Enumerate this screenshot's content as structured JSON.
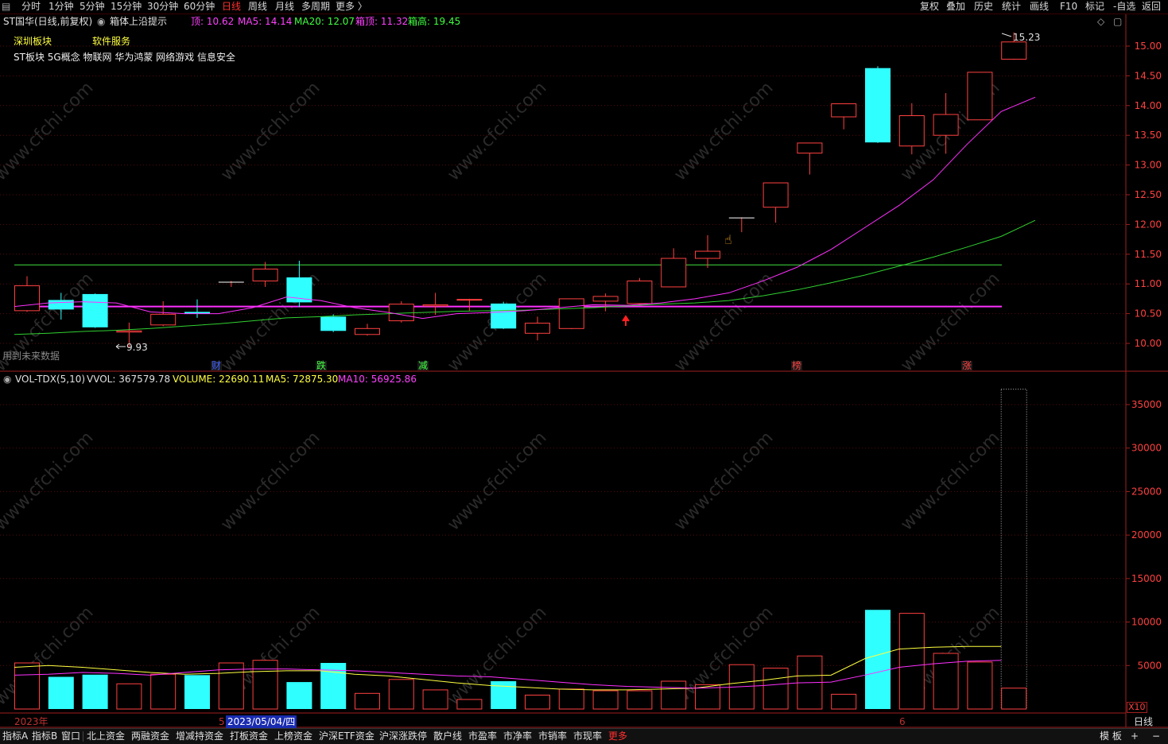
{
  "top_toolbar": {
    "periods": [
      "分时",
      "1分钟",
      "5分钟",
      "15分钟",
      "30分钟",
      "60分钟",
      "日线",
      "周线",
      "月线",
      "多周期",
      "更多 〉"
    ],
    "active_period": "日线",
    "right_tools": [
      "复权",
      "叠加",
      "历史",
      "统计",
      "画线",
      "F10",
      "标记",
      "-自选",
      "返回"
    ]
  },
  "info_bar": {
    "stock": "ST国华(日线,前复权)",
    "indicator_name": "箱体上沿提示",
    "values": [
      {
        "text": "顶: 10.62",
        "color": "#ff40ff"
      },
      {
        "text": "MA5: 14.14",
        "color": "#ff40ff"
      },
      {
        "text": "MA20: 12.07",
        "color": "#40ff40"
      },
      {
        "text": "箱顶: 11.32",
        "color": "#ff40ff"
      },
      {
        "text": "箱高: 19.45",
        "color": "#40ff40"
      }
    ]
  },
  "blocks": {
    "region": "深圳板块",
    "industry": "软件服务",
    "concepts": "ST板块 5G概念 物联网 华为鸿蒙 网络游戏 信息安全"
  },
  "price_axis": {
    "labels": [
      "15.00",
      "14.50",
      "14.00",
      "13.50",
      "13.00",
      "12.50",
      "12.00",
      "11.50",
      "11.00",
      "10.50",
      "10.00"
    ]
  },
  "annotations": {
    "high_label": "15.23",
    "low_label": "9.93",
    "future_data_note": "用到未来数据",
    "event_markers": [
      {
        "text": "财",
        "color": "#4060ff"
      },
      {
        "text": "跌",
        "color": "#40ff40"
      },
      {
        "text": "减",
        "color": "#40ff40"
      },
      {
        "text": "榜",
        "color": "#ff4040"
      },
      {
        "text": "涨",
        "color": "#ff4040"
      }
    ]
  },
  "volume_info": {
    "name": "VOL-TDX(5,10)",
    "vvol": "VVOL: 367579.78",
    "volume": "VOLUME: 22690.11",
    "ma5": "MA5: 72875.30",
    "ma10": "MA10: 56925.86"
  },
  "volume_axis": {
    "labels": [
      "35000",
      "30000",
      "25000",
      "20000",
      "15000",
      "10000",
      "5000"
    ],
    "unit": "X10"
  },
  "date_axis": {
    "year_label": "2023年",
    "cursor_date": "2023/05/04/四",
    "month5": "5",
    "month6": "6",
    "period_label": "日线"
  },
  "watermark": "www.cfchi.com",
  "chart_data": {
    "type": "candlestick",
    "ylim": [
      9.85,
      15.3
    ],
    "reference_lines": {
      "box_top": 11.32,
      "box_bottom": 10.62
    },
    "candles": [
      {
        "o": 10.55,
        "c": 10.97,
        "h": 11.13,
        "l": 10.53
      },
      {
        "o": 10.73,
        "c": 10.57,
        "h": 10.85,
        "l": 10.4
      },
      {
        "o": 10.83,
        "c": 10.27,
        "h": 10.84,
        "l": 10.26
      },
      {
        "o": 10.19,
        "c": 10.21,
        "h": 10.35,
        "l": 9.93
      },
      {
        "o": 10.31,
        "c": 10.49,
        "h": 10.71,
        "l": 10.29
      },
      {
        "o": 10.53,
        "c": 10.5,
        "h": 10.74,
        "l": 10.43
      },
      {
        "o": 11.03,
        "c": 11.03,
        "h": 11.05,
        "l": 10.95
      },
      {
        "o": 11.05,
        "c": 11.25,
        "h": 11.37,
        "l": 10.95
      },
      {
        "o": 11.11,
        "c": 10.69,
        "h": 11.39,
        "l": 10.61
      },
      {
        "o": 10.45,
        "c": 10.21,
        "h": 10.49,
        "l": 10.19
      },
      {
        "o": 10.15,
        "c": 10.25,
        "h": 10.33,
        "l": 10.13
      },
      {
        "o": 10.38,
        "c": 10.66,
        "h": 10.71,
        "l": 10.35
      },
      {
        "o": 10.63,
        "c": 10.65,
        "h": 10.85,
        "l": 10.48
      },
      {
        "o": 10.73,
        "c": 10.74,
        "h": 10.75,
        "l": 10.55
      },
      {
        "o": 10.67,
        "c": 10.25,
        "h": 10.7,
        "l": 10.24
      },
      {
        "o": 10.17,
        "c": 10.34,
        "h": 10.45,
        "l": 10.05
      },
      {
        "o": 10.25,
        "c": 10.75,
        "h": 10.75,
        "l": 10.24
      },
      {
        "o": 10.71,
        "c": 10.79,
        "h": 10.84,
        "l": 10.54
      },
      {
        "o": 10.67,
        "c": 11.05,
        "h": 11.1,
        "l": 10.65
      },
      {
        "o": 10.95,
        "c": 11.43,
        "h": 11.6,
        "l": 10.95
      },
      {
        "o": 11.43,
        "c": 11.55,
        "h": 11.82,
        "l": 11.27
      },
      {
        "o": 12.11,
        "c": 12.11,
        "h": 12.12,
        "l": 11.87
      },
      {
        "o": 12.29,
        "c": 12.7,
        "h": 12.7,
        "l": 12.03
      },
      {
        "o": 13.2,
        "c": 13.37,
        "h": 13.37,
        "l": 12.84
      },
      {
        "o": 13.81,
        "c": 14.03,
        "h": 14.03,
        "l": 13.6
      },
      {
        "o": 14.63,
        "c": 13.38,
        "h": 14.66,
        "l": 13.37
      },
      {
        "o": 13.32,
        "c": 13.83,
        "h": 14.04,
        "l": 13.18
      },
      {
        "o": 13.5,
        "c": 13.85,
        "h": 14.21,
        "l": 13.19
      },
      {
        "o": 13.76,
        "c": 14.56,
        "h": 14.56,
        "l": 13.76
      },
      {
        "o": 14.78,
        "c": 15.07,
        "h": 15.23,
        "l": 14.77
      }
    ],
    "ma5": [
      10.62,
      10.68,
      10.7,
      10.68,
      10.53,
      10.5,
      10.5,
      10.6,
      10.78,
      10.72,
      10.6,
      10.52,
      10.42,
      10.5,
      10.52,
      10.55,
      10.6,
      10.65,
      10.64,
      10.68,
      10.75,
      10.85,
      11.05,
      11.28,
      11.58,
      11.95,
      12.32,
      12.75,
      13.35,
      13.9,
      14.14
    ],
    "ma20": [
      10.15,
      10.17,
      10.2,
      10.22,
      10.25,
      10.29,
      10.33,
      10.38,
      10.43,
      10.45,
      10.48,
      10.5,
      10.52,
      10.54,
      10.55,
      10.56,
      10.58,
      10.6,
      10.63,
      10.66,
      10.68,
      10.72,
      10.8,
      10.9,
      11.02,
      11.15,
      11.3,
      11.45,
      11.62,
      11.8,
      12.07
    ],
    "volumes": [
      5300,
      3700,
      3950,
      2900,
      4000,
      3900,
      5300,
      5600,
      3100,
      5300,
      1800,
      3400,
      2200,
      1100,
      3200,
      1600,
      2300,
      2100,
      2100,
      3200,
      2800,
      5100,
      4700,
      6100,
      1700,
      11400,
      11000,
      6400,
      5400,
      36800
    ],
    "vol_max": 38500,
    "vol_ma5": [
      4800,
      5000,
      4800,
      4500,
      4200,
      4000,
      4100,
      4300,
      4400,
      4400,
      4000,
      3800,
      3400,
      3000,
      2700,
      2500,
      2300,
      2200,
      2200,
      2300,
      2400,
      2900,
      3300,
      3800,
      3900,
      5800,
      6900,
      7100,
      7200,
      7200
    ],
    "vol_ma10": [
      3900,
      4000,
      4200,
      4100,
      3900,
      4200,
      4500,
      4600,
      4600,
      4500,
      4400,
      4200,
      4000,
      3800,
      3700,
      3400,
      3100,
      2800,
      2600,
      2500,
      2400,
      2500,
      2700,
      3000,
      3100,
      3900,
      4800,
      5200,
      5500,
      5600
    ]
  }
}
